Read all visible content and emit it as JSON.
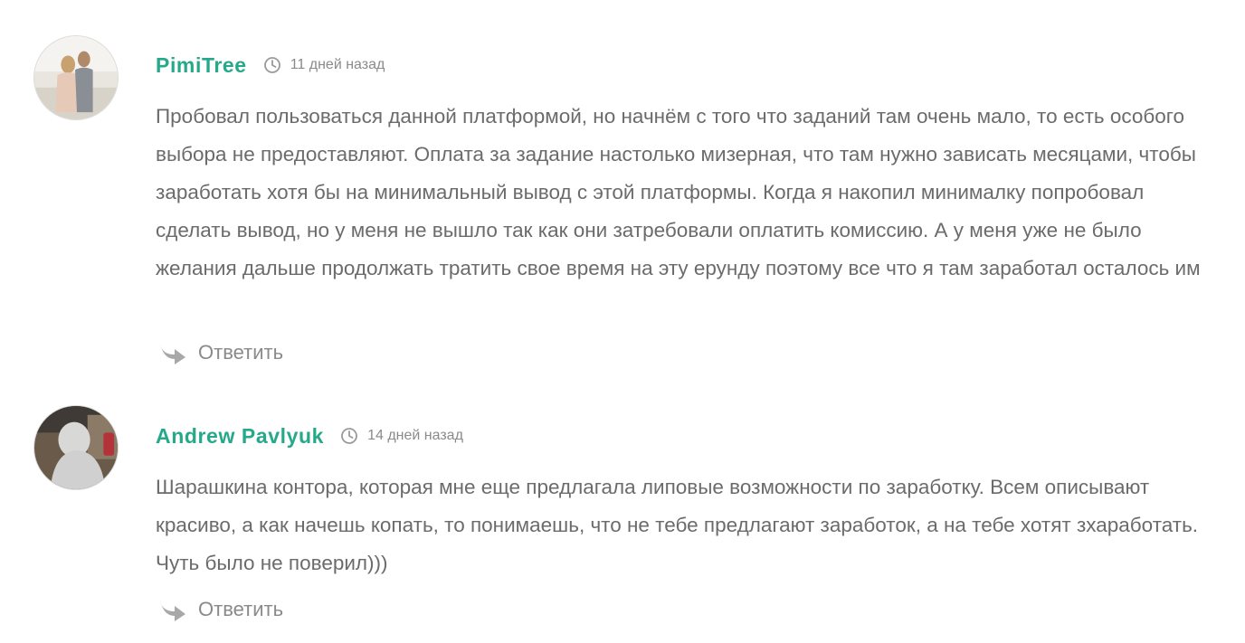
{
  "comments": [
    {
      "author": "PimiTree",
      "date": "11 дней назад",
      "text": "Пробовал пользоваться данной платформой, но начнём с того что заданий там очень мало, то есть особого выбора не предоставляют. Оплата за задание настолько мизерная, что там нужно зависать месяцами, чтобы заработать хотя бы на минимальный вывод с этой платформы. Когда я накопил минималку попробовал сделать вывод, но у меня не вышло так как они затребовали оплатить комиссию. А у меня уже не было желания дальше продолжать тратить свое время на эту ерунду поэтому все что я там заработал осталось им",
      "reply_label": "Ответить"
    },
    {
      "author": "Andrew Pavlyuk",
      "date": "14 дней назад",
      "text": "Шарашкина контора, которая мне еще предлагала липовые возможности по заработку. Всем описывают красиво, а как начешь копать, то понимаешь, что не тебе предлагают заработок, а на тебе хотят зхаработать. Чуть было не поверил)))",
      "reply_label": "Ответить"
    }
  ],
  "colors": {
    "author": "#26a88a",
    "text": "#6b6b6b",
    "muted": "#8a8a8a"
  },
  "icons": {
    "date": "clock-icon",
    "reply": "reply-arrow-icon"
  }
}
